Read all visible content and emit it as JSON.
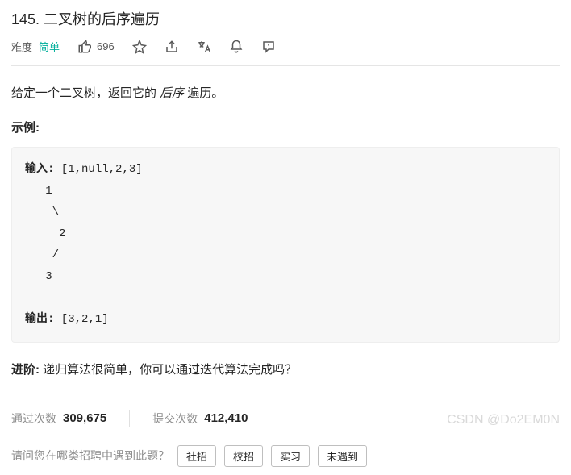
{
  "title": "145. 二叉树的后序遍历",
  "meta": {
    "difficulty_label": "难度",
    "difficulty_value": "简单",
    "likes": "696"
  },
  "description": {
    "prefix": "给定一个二叉树，返回它的 ",
    "emphasis": "后序 ",
    "suffix": "遍历。"
  },
  "example_label": "示例:",
  "code": {
    "input_label": "输入:",
    "input_value": " [1,null,2,3]",
    "tree": "   1\n    \\\n     2\n    /\n   3",
    "output_label": "输出:",
    "output_value": " [3,2,1]"
  },
  "advance": {
    "label": "进阶:",
    "text": " 递归算法很简单，你可以通过迭代算法完成吗？"
  },
  "stats": {
    "pass_label": "通过次数",
    "pass_value": "309,675",
    "submit_label": "提交次数",
    "submit_value": "412,410"
  },
  "footer": {
    "question": "请问您在哪类招聘中遇到此题？",
    "chips": [
      "社招",
      "校招",
      "实习",
      "未遇到"
    ]
  },
  "watermark": "CSDN @Do2EM0N"
}
